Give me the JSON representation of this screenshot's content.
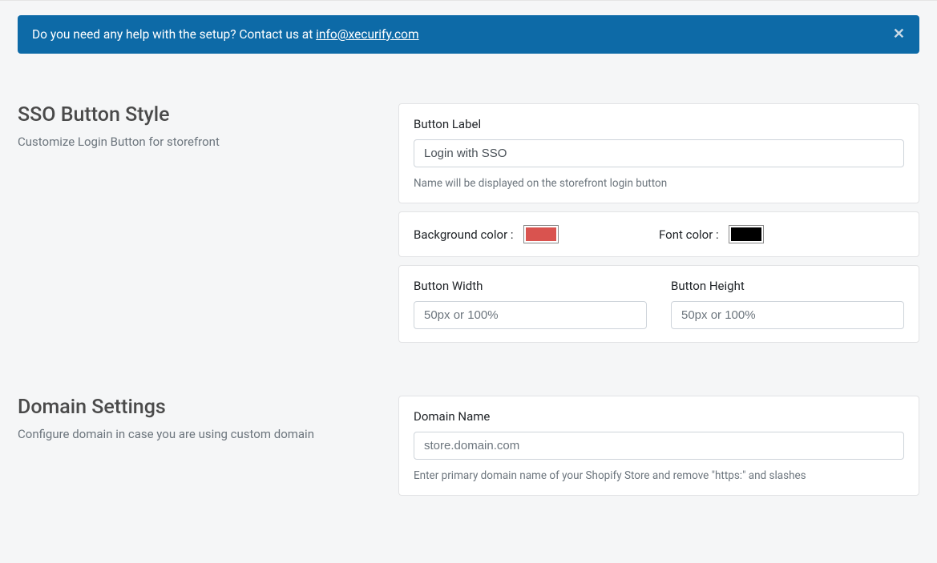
{
  "alert": {
    "prefix": "Do you need any help with the setup? Contact us at ",
    "link": "info@xecurify.com"
  },
  "ssoSection": {
    "title": "SSO Button Style",
    "subtitle": "Customize Login Button for storefront",
    "buttonLabel": {
      "label": "Button Label",
      "value": "Login with SSO",
      "help": "Name will be displayed on the storefront login button"
    },
    "bgColor": {
      "label": "Background color :",
      "value": "#d9534f"
    },
    "fontColor": {
      "label": "Font color :",
      "value": "#000000"
    },
    "width": {
      "label": "Button Width",
      "placeholder": "50px or 100%"
    },
    "height": {
      "label": "Button Height",
      "placeholder": "50px or 100%"
    }
  },
  "domainSection": {
    "title": "Domain Settings",
    "subtitle": "Configure domain in case you are using custom domain",
    "domainName": {
      "label": "Domain Name",
      "placeholder": "store.domain.com",
      "help": "Enter primary domain name of your Shopify Store and remove \"https:\" and slashes"
    }
  }
}
